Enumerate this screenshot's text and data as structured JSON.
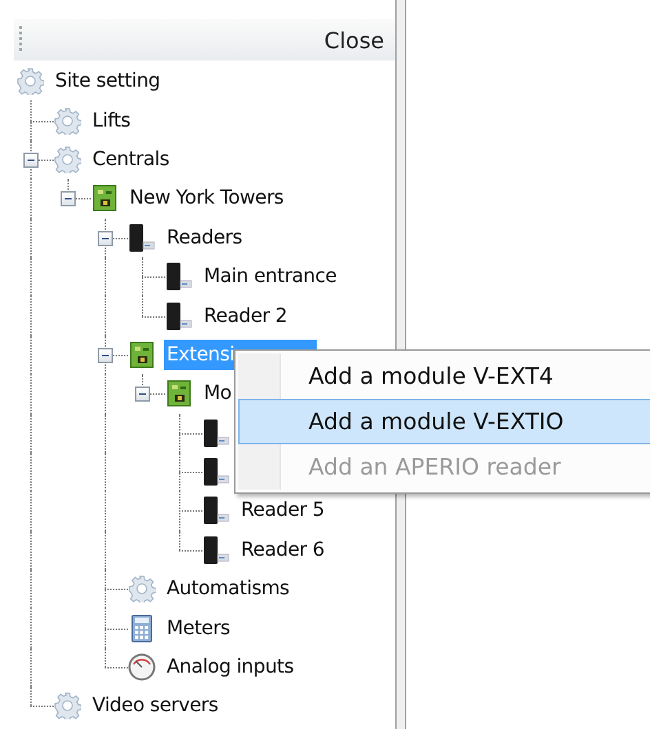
{
  "panel": {
    "close_label": "Close"
  },
  "tree": [
    {
      "label": "Site setting",
      "kind": "gear",
      "selected": false,
      "children": [
        {
          "label": "Lifts",
          "kind": "gear",
          "selected": false
        },
        {
          "label": "Centrals",
          "kind": "gear",
          "selected": false,
          "expanded": true,
          "children": [
            {
              "label": "New York Towers",
              "kind": "board",
              "selected": false,
              "expanded": true,
              "children": [
                {
                  "label": "Readers",
                  "kind": "reader",
                  "selected": false,
                  "expanded": true,
                  "children": [
                    {
                      "label": "Main entrance",
                      "kind": "reader",
                      "selected": false
                    },
                    {
                      "label": "Reader 2",
                      "kind": "reader",
                      "selected": false
                    }
                  ]
                },
                {
                  "label": "Extensi",
                  "kind": "board",
                  "selected": true,
                  "expanded": true,
                  "children": [
                    {
                      "label": "Mo",
                      "kind": "board",
                      "selected": false,
                      "expanded": true,
                      "children": [
                        {
                          "kind": "reader"
                        },
                        {
                          "kind": "reader"
                        },
                        {
                          "label": "Reader 5",
                          "kind": "reader",
                          "selected": false
                        },
                        {
                          "label": "Reader 6",
                          "kind": "reader",
                          "selected": false
                        }
                      ]
                    }
                  ]
                },
                {
                  "label": "Automatisms",
                  "kind": "gear",
                  "selected": false
                },
                {
                  "label": "Meters",
                  "kind": "calculator",
                  "selected": false
                },
                {
                  "label": "Analog inputs",
                  "kind": "gauge",
                  "selected": false
                }
              ]
            }
          ]
        },
        {
          "label": "Video servers",
          "kind": "gear",
          "selected": false
        }
      ]
    }
  ],
  "context_menu": {
    "items": [
      {
        "label": "Add a module V-EXT4",
        "selected": false,
        "disabled": false
      },
      {
        "label": "Add a module V-EXTIO",
        "selected": true,
        "disabled": false
      },
      {
        "label": "Add an APERIO reader",
        "selected": false,
        "disabled": true
      }
    ]
  }
}
